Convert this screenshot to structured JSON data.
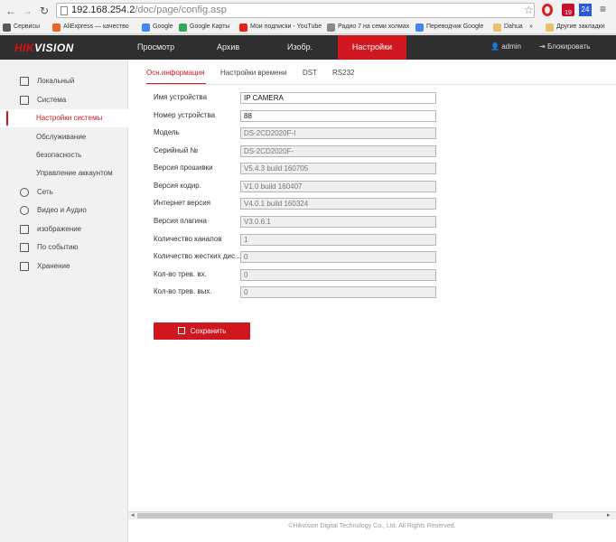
{
  "browser": {
    "url_host": "192.168.254.2",
    "url_path": "/doc/page/config.asp",
    "ext_red_badge": "19",
    "ext_blue_badge": "24",
    "bookmarks": [
      {
        "label": "Сервисы",
        "color": "#5a5a5a"
      },
      {
        "label": "AliExpress — качество",
        "color": "#e66a1f"
      },
      {
        "label": "Google",
        "color": "#4285f4"
      },
      {
        "label": "Google Карты",
        "color": "#34a853"
      },
      {
        "label": "Мои подписки - YouTube",
        "color": "#e62117"
      },
      {
        "label": "Радио 7 на семи холмах",
        "color": "#888888"
      },
      {
        "label": "Переводчик Google",
        "color": "#4285f4"
      },
      {
        "label": "Dahua",
        "color": "#e8c26a"
      },
      {
        "label": "»",
        "color": ""
      },
      {
        "label": "Другие закладки",
        "color": "#e8c26a"
      }
    ]
  },
  "app": {
    "logo_red": "HIK",
    "logo_white": "VISION",
    "nav": [
      "Просмотр",
      "Архив",
      "Изобр.",
      "Настройки"
    ],
    "user": "admin",
    "logout": "Блокировать"
  },
  "sidebar": {
    "items": [
      {
        "label": "Локальный",
        "icon": "monitor-icon"
      },
      {
        "label": "Система",
        "icon": "system-icon"
      },
      {
        "label": "Настройки системы",
        "icon": ""
      },
      {
        "label": "Обслуживание",
        "icon": ""
      },
      {
        "label": "безопасность",
        "icon": ""
      },
      {
        "label": "Управление аккаунтом",
        "icon": ""
      },
      {
        "label": "Сеть",
        "icon": "network-globe-icon"
      },
      {
        "label": "Видео и Аудио",
        "icon": "microphone-icon"
      },
      {
        "label": "изображение",
        "icon": "image-icon"
      },
      {
        "label": "По событию",
        "icon": "calendar-icon"
      },
      {
        "label": "Хранение",
        "icon": "storage-icon"
      }
    ]
  },
  "tabs": [
    "Осн.информация",
    "Настройки времени",
    "DST",
    "RS232"
  ],
  "form": {
    "rows": [
      {
        "label": "Имя устройства",
        "value": "IP CAMERA",
        "editable": true
      },
      {
        "label": "Номер устройства",
        "value": "88",
        "editable": true
      },
      {
        "label": "Модель",
        "value": "DS-2CD2020F-I",
        "editable": false
      },
      {
        "label": "Серийный №",
        "value": "DS-2CD2020F-",
        "editable": false
      },
      {
        "label": "Версия прошивки",
        "value": "V5.4.3 build 160705",
        "editable": false
      },
      {
        "label": "Версия кодир.",
        "value": "V1.0 build 160407",
        "editable": false
      },
      {
        "label": "Интернет версия",
        "value": "V4.0.1 build 160324",
        "editable": false
      },
      {
        "label": "Версия плагина",
        "value": "V3.0.6.1",
        "editable": false
      },
      {
        "label": "Количество каналов",
        "value": "1",
        "editable": false
      },
      {
        "label": "Количество жестких дис...",
        "value": "0",
        "editable": false
      },
      {
        "label": "Кол-во трев. вх.",
        "value": "0",
        "editable": false
      },
      {
        "label": "Кол-во трев. вых.",
        "value": "0",
        "editable": false
      }
    ],
    "save_label": "Сохранить"
  },
  "footer": "©Hikvision Digital Technology Co., Ltd. All Rights Reserved."
}
